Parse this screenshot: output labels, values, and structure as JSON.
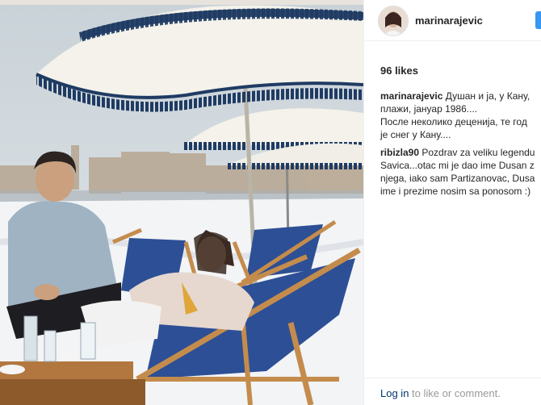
{
  "post": {
    "username": "marinarajevic",
    "likes": "96 likes",
    "photo_alt": "Vintage beach photo with umbrellas and deck chairs in snow",
    "comments": [
      {
        "user": "marinarajevic",
        "lines": [
          "Душан и ја, у Кану,",
          "плажи, јануар 1986....",
          "После неколико деценија, те год",
          "је снег у Кану...."
        ]
      },
      {
        "user": "ribizla90",
        "lines": [
          "Pozdrav za veliku legendu",
          "Savica...otac mi je dao ime Dusan z",
          "njega, iako sam Partizanovac, Dusa",
          "ime i prezime nosim sa ponosom :)"
        ]
      }
    ]
  },
  "footer": {
    "login_link": "Log in",
    "login_rest": " to like or comment."
  },
  "colors": {
    "umbrella_fabric": "#f4f2ea",
    "umbrella_fringe": "#1f3b63",
    "chair_canvas": "#2d4f95",
    "chair_wood": "#c48c4c",
    "snow": "#f2f4f6",
    "link": "#003569"
  }
}
